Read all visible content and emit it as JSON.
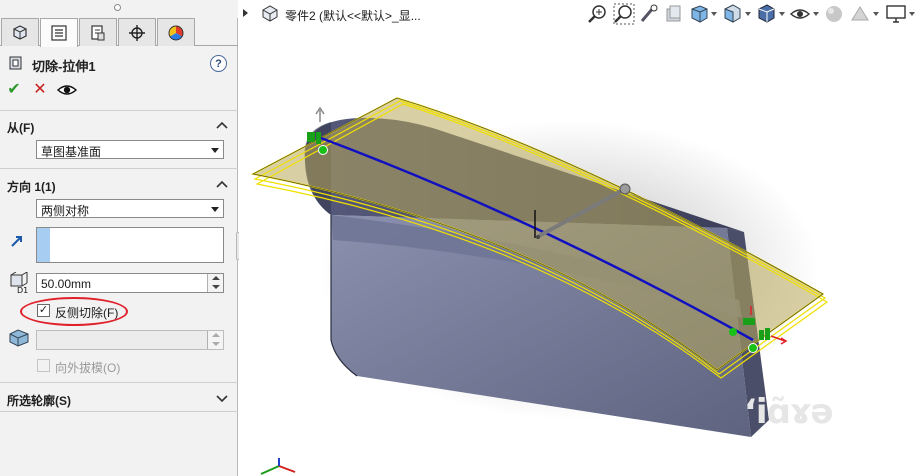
{
  "panel": {
    "tabs": [
      {
        "name": "feature-manager",
        "icon": "feature-tree-icon"
      },
      {
        "name": "property-manager",
        "icon": "property-list-icon",
        "active": true
      },
      {
        "name": "configuration-manager",
        "icon": "configuration-icon"
      },
      {
        "name": "dimxpert-manager",
        "icon": "crosshair-icon"
      },
      {
        "name": "display-manager",
        "icon": "color-wheel-icon"
      }
    ],
    "feature_title": "切除-拉伸1",
    "help_label": "?",
    "ok_label": "✔",
    "cancel_label": "✕",
    "from": {
      "label": "从(F)",
      "value": "草图基准面"
    },
    "direction1": {
      "label": "方向 1(1)",
      "end_condition": "两侧对称",
      "depth": "50.00mm",
      "flip_side_to_cut": {
        "label": "反侧切除(F)",
        "checked": true
      },
      "draft_outward": {
        "label": "向外拔模(O)",
        "checked": false
      }
    },
    "selected_contours": {
      "label": "所选轮廓(S)"
    }
  },
  "graphics": {
    "breadcrumb": "零件2 (默认<<默认>_显...",
    "watermark": "ʻiɑ̃ɤə",
    "accent_colors": {
      "plane_fill": "#b8a85a",
      "plane_edge": "#f0e000",
      "path": "#1010c0",
      "body": "#6e7490",
      "highlight": "#e0202a"
    }
  }
}
